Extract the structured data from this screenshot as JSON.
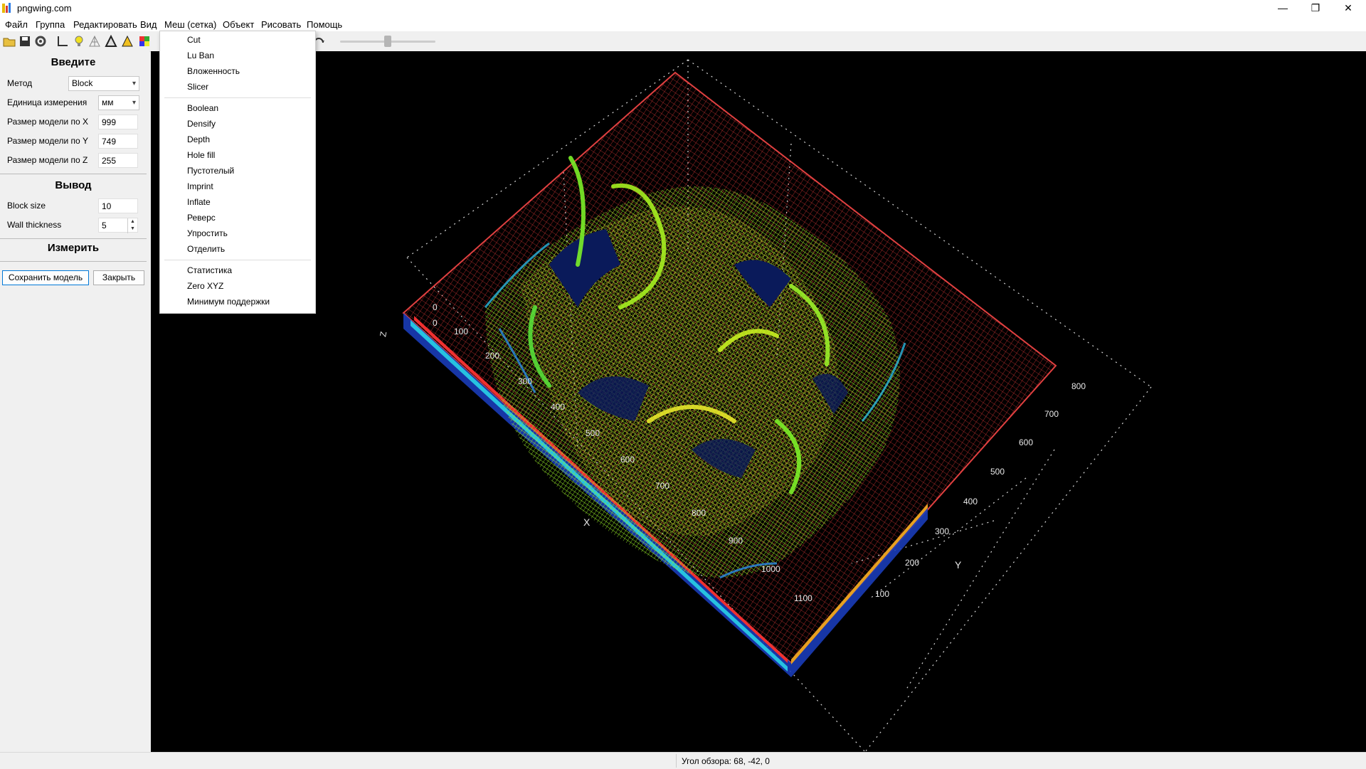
{
  "window": {
    "title": "pngwing.com",
    "controls": [
      "—",
      "❐",
      "✕"
    ]
  },
  "menubar": {
    "items": [
      "Файл",
      "Группа",
      "Редактировать",
      "Вид",
      "Меш (сетка)",
      "Объект",
      "Рисовать",
      "Помощь"
    ]
  },
  "toolbar": {
    "icons": [
      "open-folder-icon",
      "save-icon",
      "gear-icon",
      "axis-icon",
      "bulb-icon",
      "wire-mesh-icon",
      "triangle-icon",
      "warning-triangle-icon",
      "color-grid-icon",
      "rotate-icon"
    ]
  },
  "mesh_menu": {
    "group1": [
      "Cut",
      "Lu Ban",
      "Вложенность",
      "Slicer"
    ],
    "group2": [
      "Boolean",
      "Densify",
      "Depth",
      "Hole fill",
      "Пустотелый",
      "Imprint",
      "Inflate",
      "Реверс",
      "Упростить",
      "Отделить"
    ],
    "group3": [
      "Статистика",
      "Zero XYZ",
      "Минимум поддержки"
    ]
  },
  "panel": {
    "input_title": "Введите",
    "method_label": "Метод",
    "method_value": "Block",
    "unit_label": "Единица измерения",
    "unit_value": "мм",
    "size_x_label": "Размер модели по X",
    "size_x_value": "999",
    "size_y_label": "Размер модели по Y",
    "size_y_value": "749",
    "size_z_label": "Размер модели по Z",
    "size_z_value": "255",
    "output_title": "Вывод",
    "block_size_label": "Block size",
    "block_size_value": "10",
    "wall_label": "Wall thickness",
    "wall_value": "5",
    "measure_title": "Измерить",
    "save_button": "Сохранить модель",
    "close_button": "Закрыть"
  },
  "plot": {
    "axis_x_label": "X",
    "axis_y_label": "Y",
    "axis_z_label": "Z",
    "x_ticks": [
      "0",
      "100",
      "200",
      "300",
      "400",
      "500",
      "600",
      "700",
      "800",
      "900",
      "1000",
      "1100"
    ],
    "y_ticks": [
      "100",
      "200",
      "300",
      "400",
      "500",
      "600",
      "700",
      "800"
    ],
    "z_tick": "0",
    "colors": {
      "background": "#000000",
      "mesh_outline": "#d23a3a",
      "surface": "#8ee81e",
      "surface_high": "#e8e82a",
      "surface_low": "#2a8be8",
      "grid_dots": "#cfcfcf"
    }
  },
  "status": {
    "view_angle": "Угол обзора: 68, -42, 0"
  }
}
